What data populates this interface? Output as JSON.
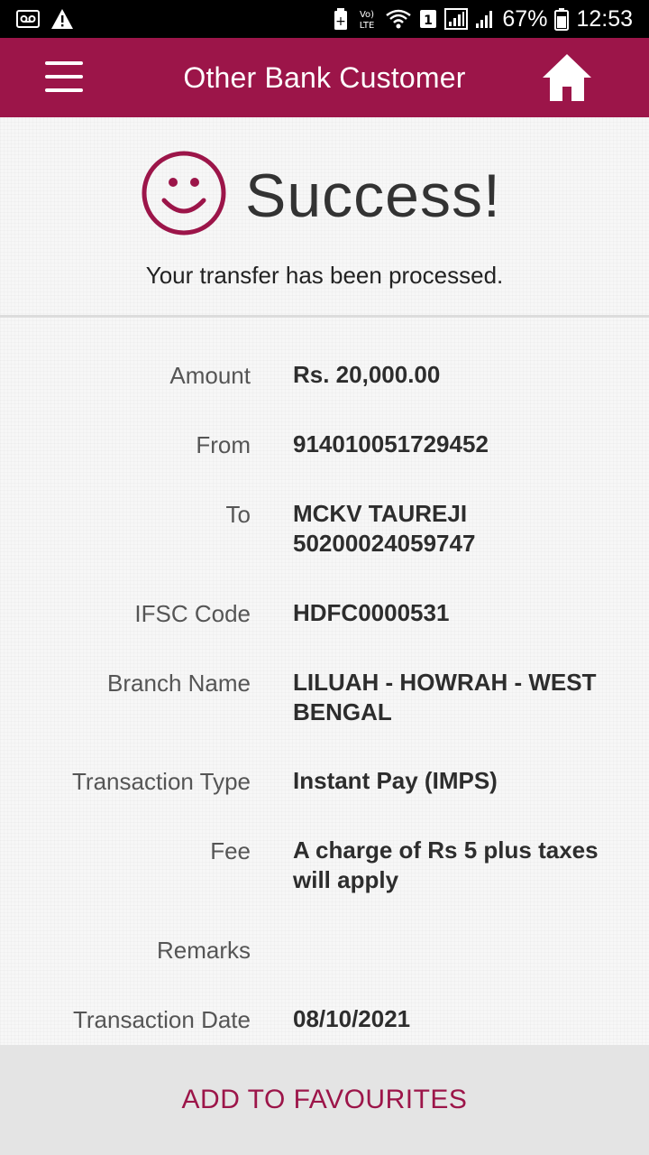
{
  "status_bar": {
    "battery": "67%",
    "time": "12:53",
    "icons": [
      "voicemail-icon",
      "warning-icon",
      "battery-saver-icon",
      "volte-icon",
      "wifi-icon",
      "sim1-icon",
      "signal-icon",
      "signal-2-icon",
      "battery-icon"
    ]
  },
  "app_bar": {
    "title": "Other Bank Customer",
    "menu_icon": "hamburger-menu-icon",
    "home_icon": "home-icon"
  },
  "success": {
    "title": "Success!",
    "message": "Your transfer has been processed.",
    "icon": "smiley-face-icon"
  },
  "details": [
    {
      "label": "Amount",
      "value": "Rs. 20,000.00"
    },
    {
      "label": "From",
      "value": "914010051729452"
    },
    {
      "label": "To",
      "value": "MCKV TAUREJI 50200024059747"
    },
    {
      "label": "IFSC Code",
      "value": "HDFC0000531"
    },
    {
      "label": "Branch Name",
      "value": "LILUAH - HOWRAH - WEST BENGAL"
    },
    {
      "label": "Transaction Type",
      "value": "Instant Pay (IMPS)"
    },
    {
      "label": "Fee",
      "value": "A charge of Rs 5 plus taxes will apply"
    },
    {
      "label": "Remarks",
      "value": ""
    },
    {
      "label": "Transaction Date",
      "value": "08/10/2021"
    }
  ],
  "actions": {
    "add_to_favourites": "ADD TO FAVOURITES"
  },
  "colors": {
    "brand": "#9c1549",
    "status_bar": "#000000",
    "bottom_bar": "#e4e4e4"
  }
}
